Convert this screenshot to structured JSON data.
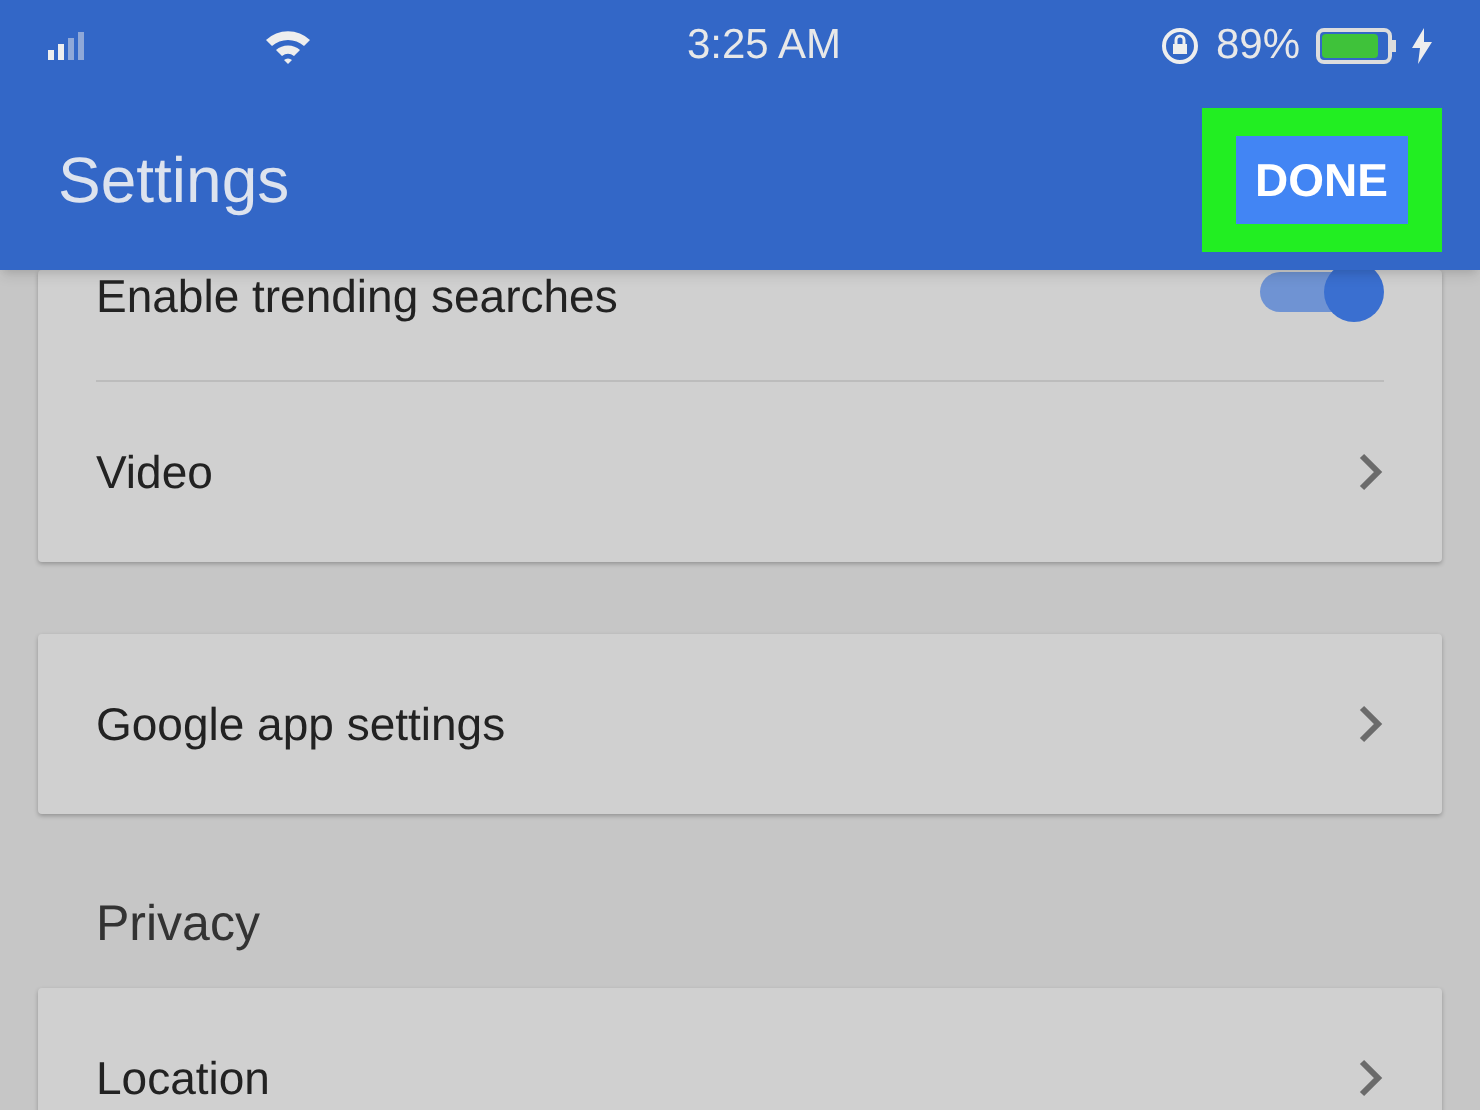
{
  "status_bar": {
    "time": "3:25 AM",
    "battery_percent": "89%",
    "charging": true
  },
  "header": {
    "title": "Settings",
    "done_button": {
      "label": "DONE",
      "highlighted": true
    }
  },
  "sections": [
    {
      "items": [
        {
          "kind": "toggle",
          "label": "Enable trending searches",
          "on": true
        },
        {
          "kind": "link",
          "label": "Video"
        }
      ]
    },
    {
      "items": [
        {
          "kind": "link",
          "label": "Google app settings"
        }
      ]
    },
    {
      "heading": "Privacy",
      "items": [
        {
          "kind": "link",
          "label": "Location"
        }
      ]
    }
  ]
}
